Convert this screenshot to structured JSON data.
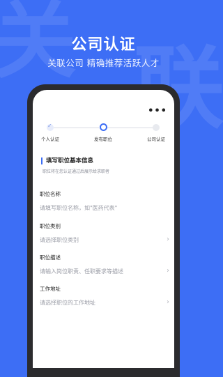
{
  "background": {
    "color": "#3d6ef5",
    "chars": [
      "关",
      "联"
    ]
  },
  "hero": {
    "title": "公司认证",
    "subtitle": "关联公司  精确推荐活跃人才"
  },
  "header": {
    "more_icon": "more-horizontal-icon",
    "more_glyph": "•••"
  },
  "steps": [
    {
      "label": "个人认证",
      "state": "done"
    },
    {
      "label": "发布职位",
      "state": "active"
    },
    {
      "label": "公司认证",
      "state": "todo"
    }
  ],
  "section": {
    "title": "填写职位基本信息",
    "hint": "职位将在您认证通过后展示给求职者"
  },
  "fields": [
    {
      "label": "职位名称",
      "placeholder": "请填写职位名称，如\"医药代表\"",
      "has_chevron": false
    },
    {
      "label": "职位类别",
      "placeholder": "请选择职位类别",
      "has_chevron": true
    },
    {
      "label": "职位描述",
      "placeholder": "请输入岗位职责、任职要求等描述",
      "has_chevron": true
    },
    {
      "label": "工作地址",
      "placeholder": "请选择职位的工作地址",
      "has_chevron": true
    }
  ],
  "colors": {
    "accent": "#3d6ef5",
    "phone_frame": "#2b2b2e"
  }
}
